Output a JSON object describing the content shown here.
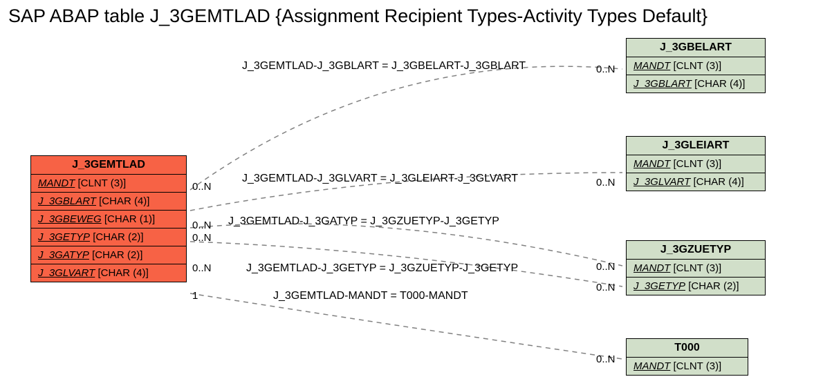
{
  "title": "SAP ABAP table J_3GEMTLAD {Assignment Recipient Types-Activity Types Default}",
  "mainEntity": {
    "name": "J_3GEMTLAD",
    "fields": [
      {
        "key": "MANDT",
        "type": " [CLNT (3)]"
      },
      {
        "key": "J_3GBLART",
        "type": " [CHAR (4)]"
      },
      {
        "key": "J_3GBEWEG",
        "type": " [CHAR (1)]"
      },
      {
        "key": "J_3GETYP",
        "type": " [CHAR (2)]"
      },
      {
        "key": "J_3GATYP",
        "type": " [CHAR (2)]"
      },
      {
        "key": "J_3GLVART",
        "type": " [CHAR (4)]"
      }
    ]
  },
  "refEntities": [
    {
      "name": "J_3GBELART",
      "fields": [
        {
          "key": "MANDT",
          "type": " [CLNT (3)]"
        },
        {
          "key": "J_3GBLART",
          "type": " [CHAR (4)]"
        }
      ]
    },
    {
      "name": "J_3GLEIART",
      "fields": [
        {
          "key": "MANDT",
          "type": " [CLNT (3)]"
        },
        {
          "key": "J_3GLVART",
          "type": " [CHAR (4)]"
        }
      ]
    },
    {
      "name": "J_3GZUETYP",
      "fields": [
        {
          "key": "MANDT",
          "type": " [CLNT (3)]"
        },
        {
          "key": "J_3GETYP",
          "type": " [CHAR (2)]"
        }
      ]
    },
    {
      "name": "T000",
      "fields": [
        {
          "key": "MANDT",
          "type": " [CLNT (3)]"
        }
      ]
    }
  ],
  "edges": [
    {
      "label": "J_3GEMTLAD-J_3GBLART = J_3GBELART-J_3GBLART",
      "leftCard": "0..N",
      "rightCard": "0..N"
    },
    {
      "label": "J_3GEMTLAD-J_3GLVART = J_3GLEIART-J_3GLVART",
      "leftCard": "0..N",
      "rightCard": "0..N"
    },
    {
      "label": "J_3GEMTLAD-J_3GATYP = J_3GZUETYP-J_3GETYP",
      "leftCard": "0..N",
      "rightCard": "0..N"
    },
    {
      "label": "J_3GEMTLAD-J_3GETYP = J_3GZUETYP-J_3GETYP",
      "leftCard": "0..N",
      "rightCard": "0..N"
    },
    {
      "label": "J_3GEMTLAD-MANDT = T000-MANDT",
      "leftCard": "1",
      "rightCard": "0..N"
    }
  ]
}
